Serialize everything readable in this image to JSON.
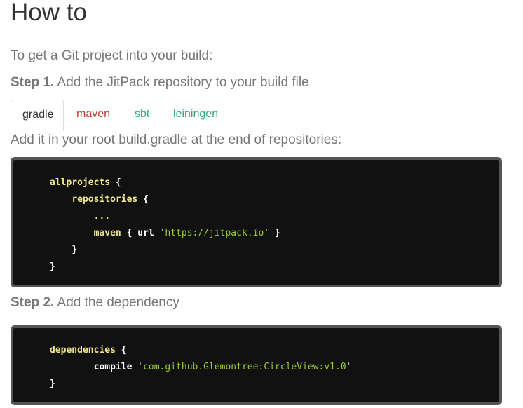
{
  "page": {
    "title": "How to",
    "intro": "To get a Git project into your build:"
  },
  "step1": {
    "label": "Step 1.",
    "text": "Add the JitPack repository to your build file"
  },
  "tabs": [
    {
      "label": "gradle",
      "color": "#333333",
      "active": true
    },
    {
      "label": "maven",
      "color": "#c0392b",
      "active": false
    },
    {
      "label": "sbt",
      "color": "#2ea87a",
      "active": false
    },
    {
      "label": "leiningen",
      "color": "#2ea87a",
      "active": false
    }
  ],
  "instruction": "Add it in your root build.gradle at the end of repositories:",
  "code1": {
    "line1_kw": "allprojects",
    "line1_brace": " {",
    "line2_kw": "repositories",
    "line2_brace": " {",
    "line3": "...",
    "line4_kw": "maven",
    "line4_mid": " { url ",
    "line4_str": "'https://jitpack.io'",
    "line4_end": " }",
    "line5": "}",
    "line6": "}"
  },
  "step2": {
    "label": "Step 2.",
    "text": "Add the dependency"
  },
  "code2": {
    "line1_kw": "dependencies",
    "line1_brace": " {",
    "line2_kw": "compile",
    "line2_str": "'com.github.Glemontree:CircleView:v1.0'",
    "line3": "}"
  },
  "colors": {
    "code_background": "#111111",
    "code_border": "#555555",
    "keyword": "#f0e68c",
    "string": "#9acd32"
  }
}
